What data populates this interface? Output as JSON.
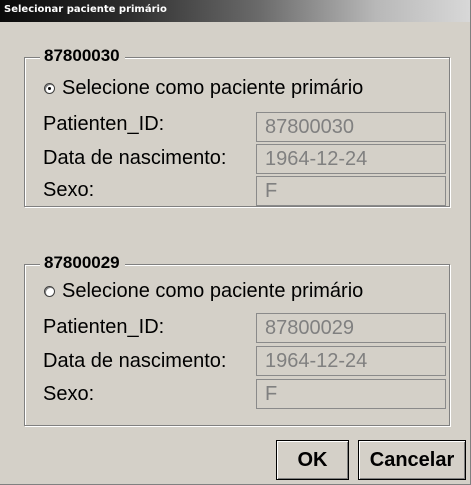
{
  "window": {
    "title": "Selecionar paciente primário"
  },
  "patients": [
    {
      "group_title": "87800030",
      "radio_label": "Selecione como paciente primário",
      "selected": true,
      "fields": [
        {
          "label": "Patienten_ID:",
          "value": "87800030"
        },
        {
          "label": "Data de nascimento:",
          "value": "1964-12-24"
        },
        {
          "label": "Sexo:",
          "value": "F"
        }
      ]
    },
    {
      "group_title": "87800029",
      "radio_label": "Selecione como paciente primário",
      "selected": false,
      "fields": [
        {
          "label": "Patienten_ID:",
          "value": "87800029"
        },
        {
          "label": "Data de nascimento:",
          "value": "1964-12-24"
        },
        {
          "label": "Sexo:",
          "value": "F"
        }
      ]
    }
  ],
  "buttons": {
    "ok_label": "OK",
    "cancel_label": "Cancelar"
  },
  "colors": {
    "dialog_background": "#d4d0c8",
    "disabled_text": "#808080"
  }
}
